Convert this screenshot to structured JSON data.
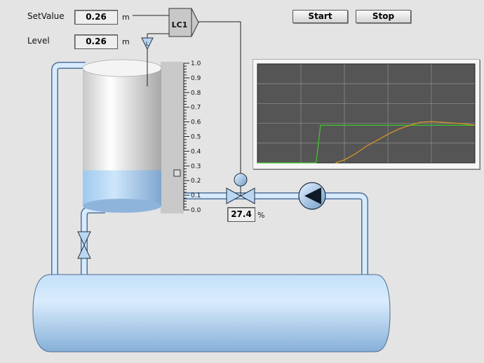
{
  "controls": {
    "setvalue_label": "SetValue",
    "setvalue_value": "0.26",
    "setvalue_unit": "m",
    "level_label": "Level",
    "level_value": "0.26",
    "level_unit": "m",
    "start_label": "Start",
    "stop_label": "Stop"
  },
  "controller": {
    "label": "LC1"
  },
  "valve": {
    "position_value": "27.4",
    "position_unit": "%"
  },
  "scale": {
    "ticks": [
      "1.0",
      "0.9",
      "0.8",
      "0.7",
      "0.6",
      "0.5",
      "0.4",
      "0.3",
      "0.2",
      "0.1",
      "0.0"
    ]
  },
  "tank": {
    "level_fraction": 0.26
  },
  "trend": {
    "colors": {
      "setpoint": "#3ecb2b",
      "level": "#e09820",
      "background": "#555555",
      "grid": "#8a8a8a"
    },
    "y_range": [
      0,
      1
    ],
    "setpoint_points": [
      [
        0,
        0
      ],
      [
        0.27,
        0
      ],
      [
        0.28,
        0.25
      ],
      [
        0.29,
        0.5
      ],
      [
        1,
        0.5
      ]
    ],
    "level_points": [
      [
        0.36,
        0
      ],
      [
        0.4,
        0.04
      ],
      [
        0.45,
        0.12
      ],
      [
        0.5,
        0.22
      ],
      [
        0.55,
        0.3
      ],
      [
        0.6,
        0.38
      ],
      [
        0.65,
        0.45
      ],
      [
        0.7,
        0.5
      ],
      [
        0.75,
        0.54
      ],
      [
        0.8,
        0.55
      ],
      [
        0.85,
        0.54
      ],
      [
        0.9,
        0.53
      ],
      [
        0.95,
        0.52
      ],
      [
        1,
        0.5
      ]
    ]
  }
}
